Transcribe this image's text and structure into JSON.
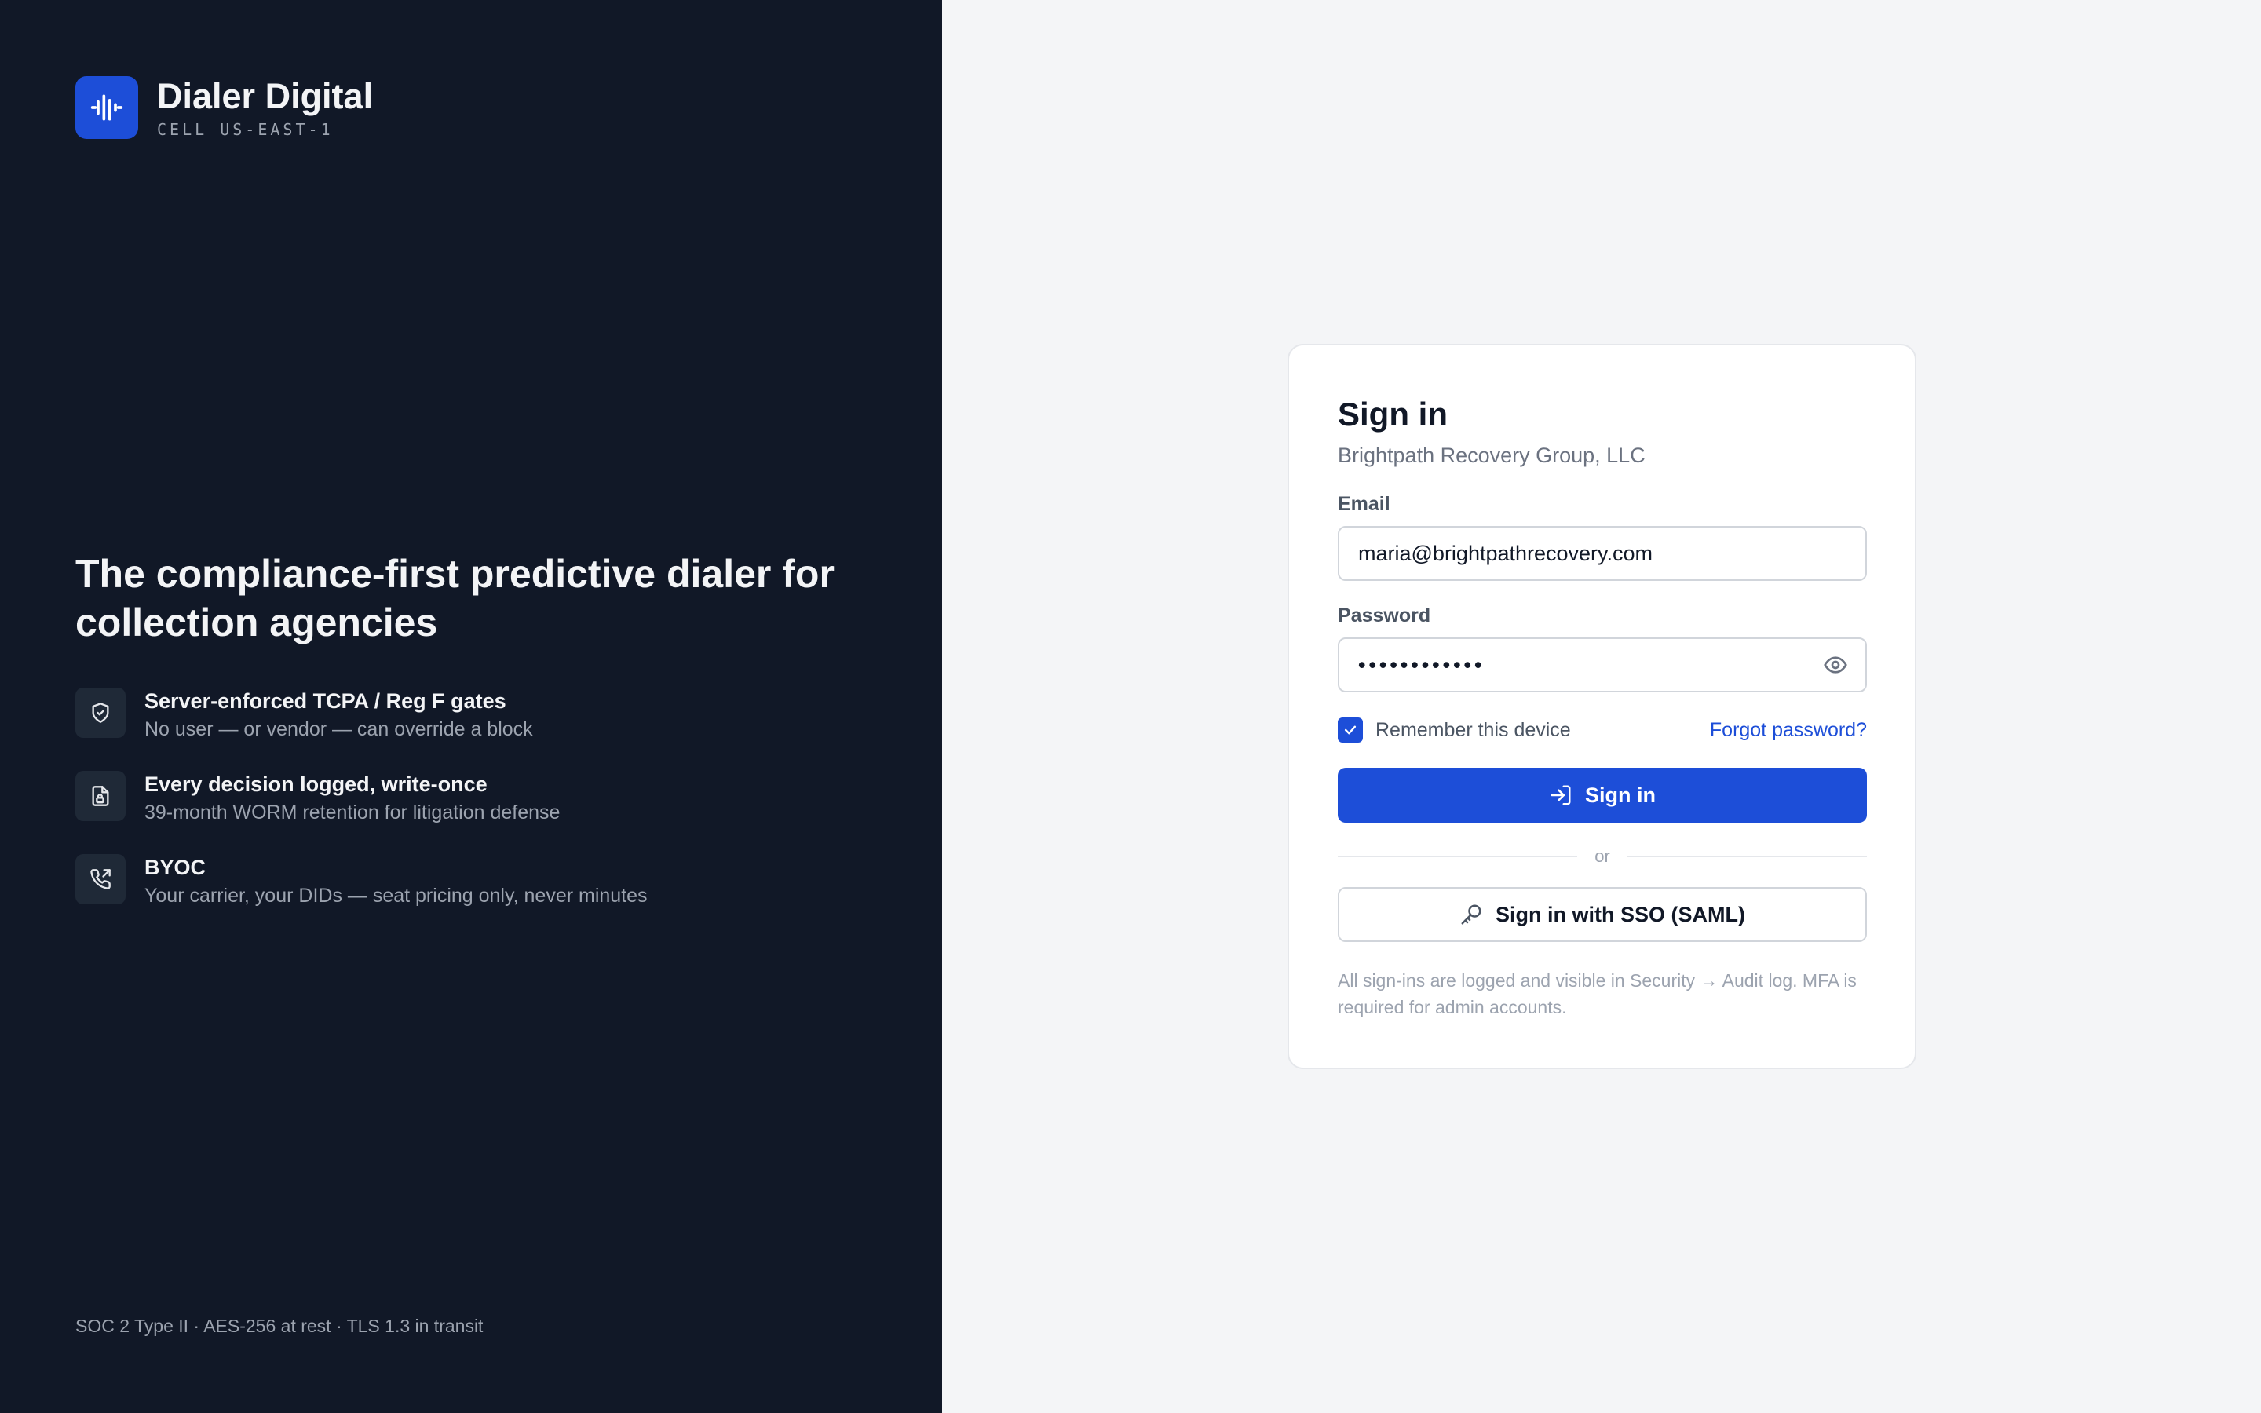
{
  "brand": {
    "name": "Dialer Digital",
    "cell": "CELL US-EAST-1"
  },
  "hero": {
    "headline": "The compliance-first predictive dialer for collection agencies",
    "features": [
      {
        "icon": "shield-check-icon",
        "title": "Server-enforced TCPA / Reg F gates",
        "subtitle": "No user — or vendor — can override a block"
      },
      {
        "icon": "file-lock-icon",
        "title": "Every decision logged, write-once",
        "subtitle": "39-month WORM retention for litigation defense"
      },
      {
        "icon": "phone-outgoing-icon",
        "title": "BYOC",
        "subtitle": "Your carrier, your DIDs — seat pricing only, never minutes"
      }
    ],
    "footer": "SOC 2 Type II · AES-256 at rest · TLS 1.3 in transit"
  },
  "signin": {
    "title": "Sign in",
    "organization": "Brightpath Recovery Group, LLC",
    "email_label": "Email",
    "email_value": "maria@brightpathrecovery.com",
    "password_label": "Password",
    "password_value": "••••••••••••",
    "remember_label": "Remember this device",
    "remember_checked": true,
    "forgot_label": "Forgot password?",
    "submit_label": "Sign in",
    "divider_label": "or",
    "sso_label": "Sign in with SSO (SAML)",
    "note": "All sign-ins are logged and visible in Security → Audit log. MFA is required for admin accounts."
  },
  "colors": {
    "accent": "#1d4ed8",
    "left_panel_bg": "#111827",
    "right_panel_bg": "#f4f5f7"
  }
}
